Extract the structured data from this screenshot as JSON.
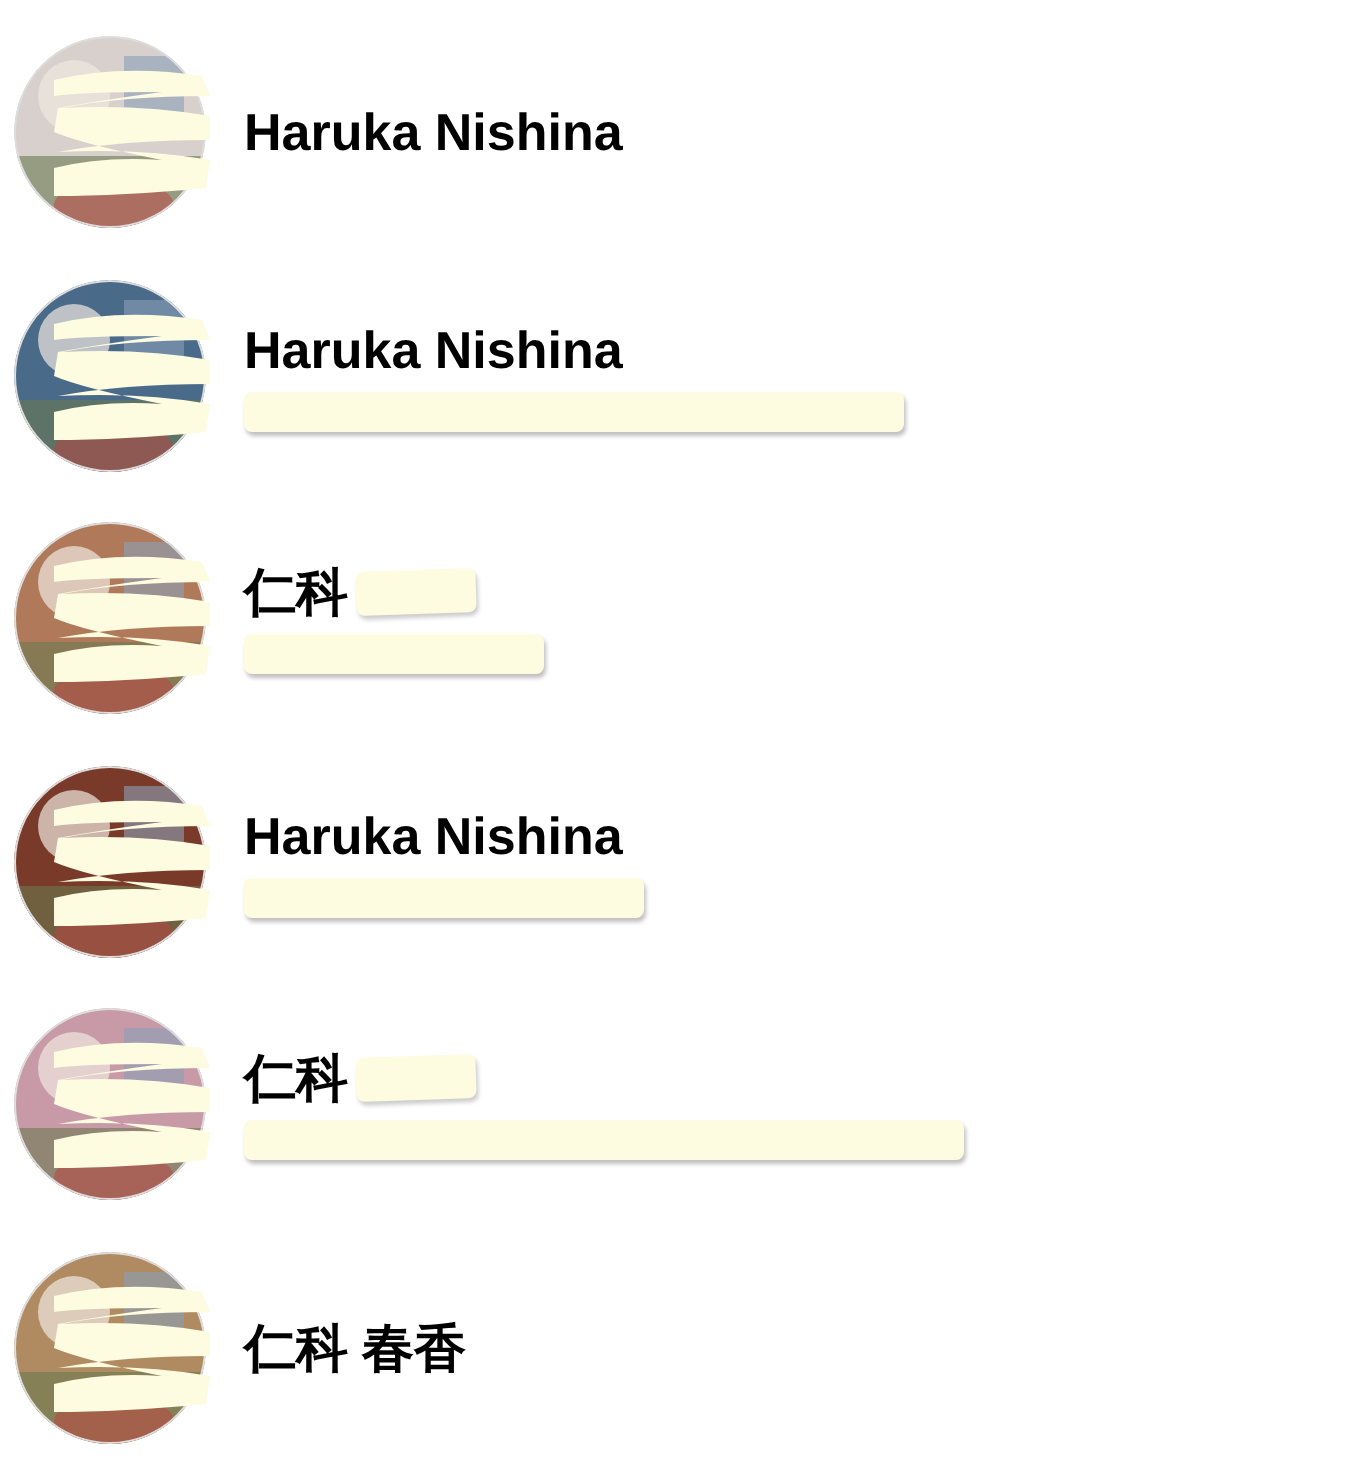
{
  "contacts": [
    {
      "name": "Haruka Nishina",
      "name_redacted": false,
      "detail_redacted": false
    },
    {
      "name": "Haruka Nishina",
      "name_redacted": false,
      "detail_redacted": true
    },
    {
      "name": "仁科",
      "name_redacted": true,
      "detail_redacted": true
    },
    {
      "name": "Haruka Nishina",
      "name_redacted": false,
      "detail_redacted": true
    },
    {
      "name": "仁科",
      "name_redacted": true,
      "detail_redacted": true
    },
    {
      "name": "仁科 春香",
      "name_redacted": false,
      "detail_redacted": false
    }
  ]
}
